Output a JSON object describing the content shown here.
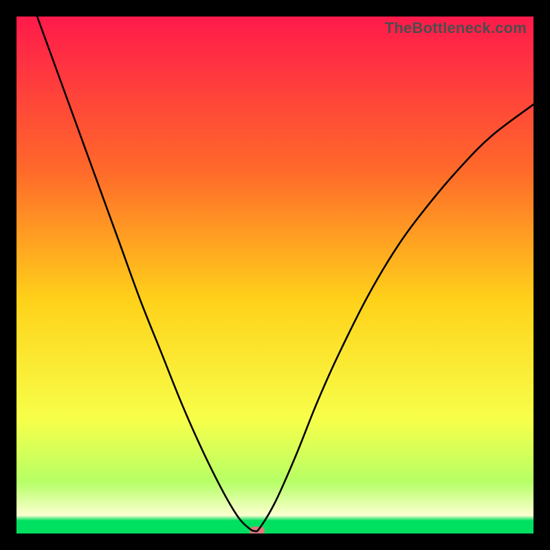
{
  "watermark": "TheBottleneck.com",
  "chart_data": {
    "type": "line",
    "title": "",
    "xlabel": "",
    "ylabel": "",
    "xlim": [
      0,
      100
    ],
    "ylim": [
      0,
      100
    ],
    "gradient_stops": [
      {
        "t": 0.0,
        "color": "#ff1a4b"
      },
      {
        "t": 0.3,
        "color": "#ff6a2a"
      },
      {
        "t": 0.55,
        "color": "#ffd21a"
      },
      {
        "t": 0.78,
        "color": "#f7ff4a"
      },
      {
        "t": 0.9,
        "color": "#b6ff66"
      },
      {
        "t": 0.965,
        "color": "#fbffd0"
      },
      {
        "t": 0.975,
        "color": "#00e060"
      },
      {
        "t": 1.0,
        "color": "#00e060"
      }
    ],
    "series": [
      {
        "name": "bottleneck-curve",
        "x": [
          4,
          8,
          12,
          16,
          20,
          24,
          28,
          32,
          36,
          40,
          43,
          45,
          46,
          47,
          50,
          54,
          58,
          62,
          68,
          74,
          80,
          86,
          92,
          100
        ],
        "y": [
          100,
          89,
          78,
          67,
          56,
          45,
          35,
          25,
          16,
          8,
          3,
          1,
          0.5,
          1,
          6,
          15,
          25,
          34,
          46,
          56,
          64,
          71,
          77,
          83
        ]
      }
    ],
    "marker": {
      "x": 46.5,
      "y": 0.5,
      "color": "#d97a7a"
    }
  }
}
